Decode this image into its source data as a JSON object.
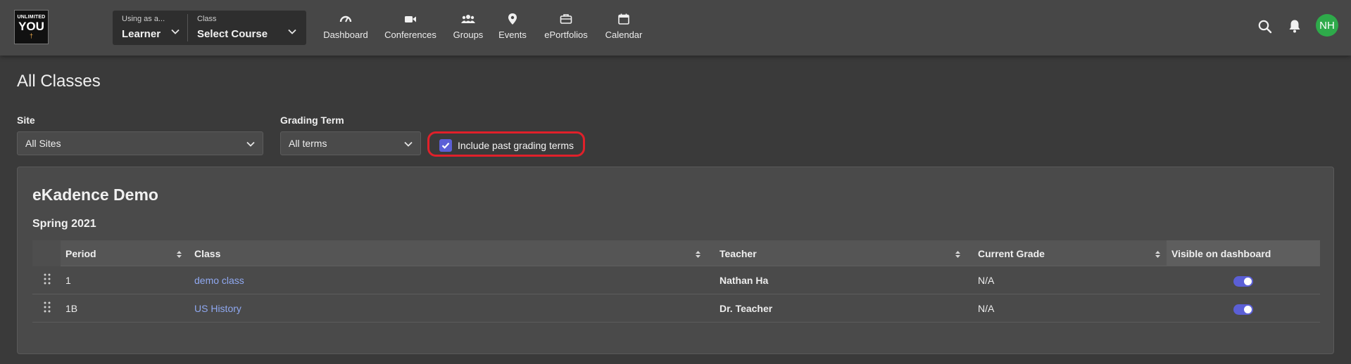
{
  "logo": {
    "line1": "UNLIMITED",
    "line2": "YOU",
    "mark": "†"
  },
  "context": {
    "role_small": "Using as a...",
    "role_value": "Learner",
    "class_small": "Class",
    "class_value": "Select Course"
  },
  "nav": [
    {
      "label": "Dashboard",
      "icon": "gauge-icon"
    },
    {
      "label": "Conferences",
      "icon": "video-camera-icon"
    },
    {
      "label": "Groups",
      "icon": "users-icon"
    },
    {
      "label": "Events",
      "icon": "map-pin-icon"
    },
    {
      "label": "ePortfolios",
      "icon": "briefcase-icon"
    },
    {
      "label": "Calendar",
      "icon": "calendar-icon"
    }
  ],
  "user": {
    "initials": "NH",
    "avatar_color": "#2eaa4a"
  },
  "page": {
    "title": "All Classes"
  },
  "filters": {
    "site_label": "Site",
    "site_value": "All Sites",
    "term_label": "Grading Term",
    "term_value": "All terms",
    "past_terms_label": "Include past grading terms",
    "past_terms_checked": true
  },
  "org": {
    "name": "eKadence Demo",
    "term": "Spring 2021",
    "columns": [
      "Period",
      "Class",
      "Teacher",
      "Current Grade",
      "Visible on dashboard"
    ],
    "rows": [
      {
        "period": "1",
        "class": "demo class",
        "teacher": "Nathan Ha",
        "grade": "N/A",
        "visible": true
      },
      {
        "period": "1B",
        "class": "US History",
        "teacher": "Dr. Teacher",
        "grade": "N/A",
        "visible": true
      }
    ]
  },
  "colors": {
    "accent": "#5b5fd6",
    "link": "#8fa8f0",
    "highlight": "#e0202a"
  }
}
